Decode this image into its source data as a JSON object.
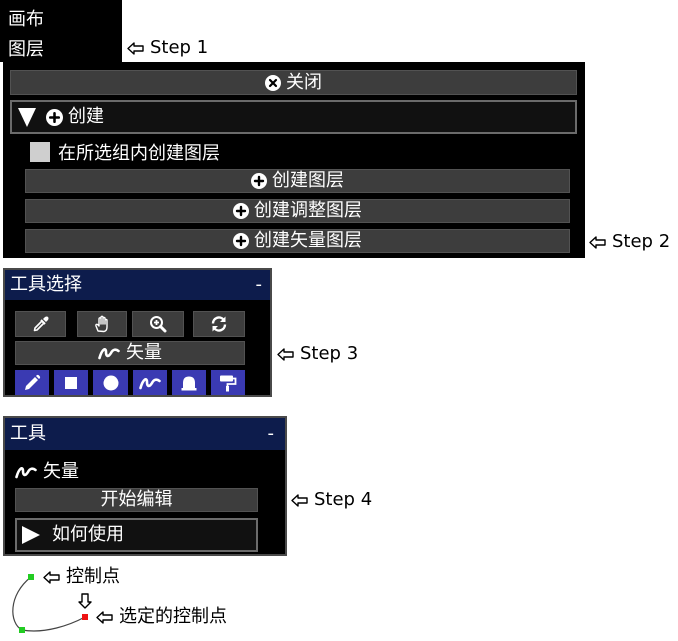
{
  "menu": {
    "items": [
      {
        "label": "画布"
      },
      {
        "label": "图层"
      }
    ]
  },
  "steps": [
    "Step 1",
    "Step 2",
    "Step 3",
    "Step 4"
  ],
  "layer_panel": {
    "close_label": "关闭",
    "close_icon": "times-circle-icon",
    "create_section": {
      "label": "创建",
      "expanded": true,
      "icon": "plus-circle-icon"
    },
    "checkbox": {
      "label": "在所选组内创建图层",
      "checked": false
    },
    "buttons": [
      {
        "label": "创建图层",
        "icon": "plus-circle-icon"
      },
      {
        "label": "创建调整图层",
        "icon": "plus-circle-icon"
      },
      {
        "label": "创建矢量图层",
        "icon": "plus-circle-icon"
      }
    ]
  },
  "tool_select_panel": {
    "title": "工具选择",
    "collapse_label": "-",
    "action_icons": [
      "eyedropper-icon",
      "hand-icon",
      "zoom-in-icon",
      "refresh-icon"
    ],
    "vector_button": {
      "label": "矢量",
      "icon": "vector-squiggle-icon"
    },
    "tool_icons": [
      "pencil-icon",
      "square-icon",
      "circle-icon",
      "vector-squiggle-icon",
      "bell-icon",
      "paint-roller-icon"
    ]
  },
  "tool_panel": {
    "title": "工具",
    "collapse_label": "-",
    "mode": {
      "label": "矢量",
      "icon": "vector-squiggle-icon"
    },
    "start_edit_label": "开始编辑",
    "how_to": {
      "label": "如何使用",
      "expanded": false
    }
  },
  "legend": {
    "control_point_label": "控制点",
    "selected_control_point_label": "选定的控制点"
  },
  "colors": {
    "panel_bg": "#000000",
    "button_bg": "#3d3d3d",
    "header_bg": "#0d1c4c",
    "tool_button_bg": "#3a3ab2",
    "control_point": "#22cc22",
    "selected_control_point": "#ee1111"
  }
}
